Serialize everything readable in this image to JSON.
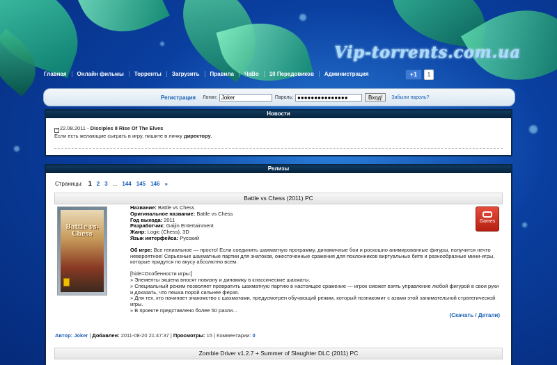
{
  "site": {
    "logo": "Vip-torrents.com.ua"
  },
  "nav": [
    "Главная",
    "Онлайн фильмы",
    "Торренты",
    "Загрузить",
    "Правила",
    "ЧаВо",
    "10 Передовиков",
    "Администрация"
  ],
  "gplus": {
    "label": "+1",
    "count": "1"
  },
  "login": {
    "register": "Регистрация",
    "login_label": "Логин:",
    "login_value": "Joker",
    "password_label": "Пароль:",
    "password_value": "●●●●●●●●●●●●●●●",
    "enter": "Вход!",
    "forgot": "Забыли пароль?"
  },
  "news": {
    "header": "Новости",
    "date": "22.08.2011",
    "title": "Disciples II Rise Of The Elves",
    "text": "Если есть желающие сыграть в игру, пишите в личку",
    "text_bold": "директору",
    "text_end": "."
  },
  "releases": {
    "header": "Релизы",
    "pages_label": "Страницы:",
    "current_page": "1",
    "pages": [
      "2",
      "3",
      "...",
      "144",
      "145",
      "146",
      "»"
    ],
    "items": [
      {
        "title": "Battle vs Chess (2011) PC",
        "cover_text": "Battle vs. Chess",
        "badge": "Games",
        "name_label": "Название:",
        "name": "Battle vs Chess",
        "orig_label": "Оригинальное название:",
        "orig": "Battle vs Chess",
        "year_label": "Год выхода:",
        "year": "2011",
        "dev_label": "Разработчик:",
        "dev": "Gaijin Entertainment",
        "genre_label": "Жанр:",
        "genre": "Logic (Chess), 3D",
        "lang_label": "Язык интерфейса:",
        "lang": "Русский",
        "about_label": "Об игре:",
        "about": "Все гениальное — просто! Если соединить шахматную программу, динамичные бои и роскошно анимированные фигуры, получится нечто невероятное! Серьезные шахматные партии для знатоков, ожесточенные сражения для поклонников виртуальных битв и разнообразные мини-игры, которые придутся по вкусу абсолютно всем.",
        "features_title": "[hide=Особенности игры:]",
        "features": [
          "» Элементы экшена вносят новизну и динамику в классические шахматы.",
          "» Специальный режим позволяет превратить шахматную партию в настоящее сражение — игрок сможет взять управление любой фигурой в свои руки и доказать, что пешка порой сильнее ферзя.",
          "» Для тех, кто начинает знакомство с шахматами, предусмотрен обучающий режим, который познакомит с азами этой занимательной стратегической игры.",
          "» В проекте представлено более 50 разли..."
        ],
        "more": "(Скачать / Детали)",
        "author_label": "Автор:",
        "author": "Joker",
        "added_label": "Добавлен:",
        "added": "2011-08-20 21:47:37",
        "views_label": "Просмотры:",
        "views": "15",
        "comments_label": "Комментарии:",
        "comments": "0"
      },
      {
        "title": "Zombie Driver v1.2.7 + Summer of Slaughter DLC (2011) PC"
      }
    ]
  }
}
